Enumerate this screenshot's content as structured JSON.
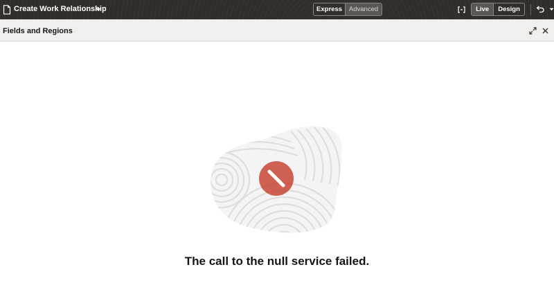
{
  "topbar": {
    "page_title": "Create Work Relationship",
    "icons": {
      "page": "page-icon",
      "title_menu": "chevron-down-icon",
      "code": "code-brackets-icon",
      "undo": "undo-icon",
      "undo_menu": "chevron-down-icon"
    },
    "mode_toggle": {
      "options": [
        "Express",
        "Advanced"
      ],
      "selected": "Express"
    },
    "view_toggle": {
      "options": [
        "Live",
        "Design"
      ],
      "selected": "Live"
    }
  },
  "panel": {
    "title": "Fields and Regions",
    "icons": {
      "expand": "expand-icon",
      "close": "close-icon"
    }
  },
  "main": {
    "error_message": "The call to the null service failed.",
    "illustration_icon": "error-blocked-icon"
  },
  "colors": {
    "toolbar_bg": "#312d2a",
    "panel_header_bg": "#f1efed",
    "error_accent": "#c74634",
    "text_primary": "#161513"
  }
}
